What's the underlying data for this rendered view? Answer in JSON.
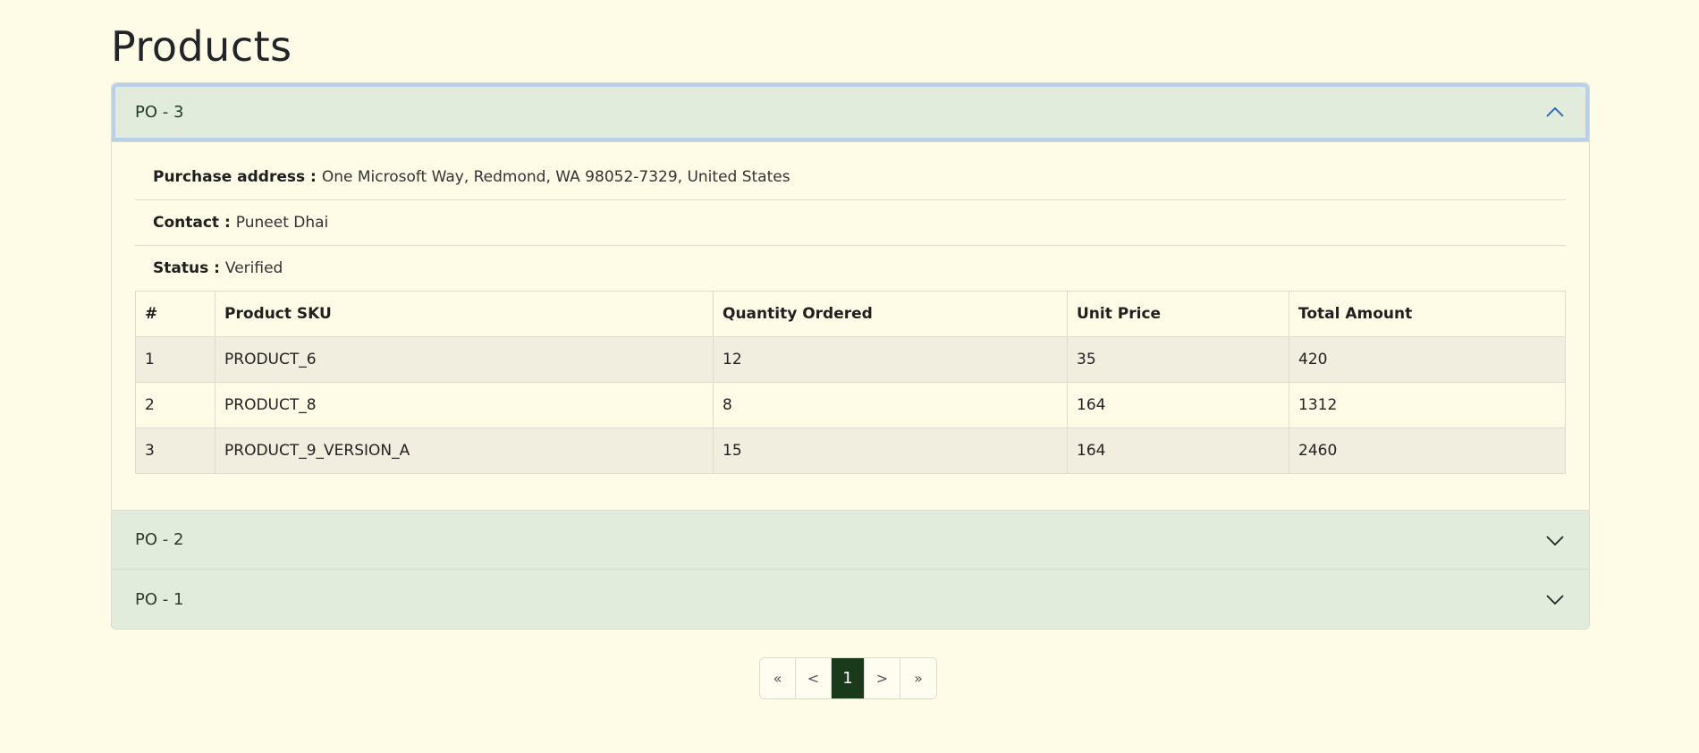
{
  "page": {
    "title": "Products"
  },
  "orders": [
    {
      "label": "PO - 3",
      "expanded": true,
      "details": {
        "address_label": "Purchase address :",
        "address": "One Microsoft Way, Redmond, WA 98052-7329, United States",
        "contact_label": "Contact :",
        "contact": "Puneet Dhai",
        "status_label": "Status :",
        "status": "Verified"
      },
      "table": {
        "columns": [
          "#",
          "Product SKU",
          "Quantity Ordered",
          "Unit Price",
          "Total Amount"
        ],
        "rows": [
          [
            "1",
            "PRODUCT_6",
            "12",
            "35",
            "420"
          ],
          [
            "2",
            "PRODUCT_8",
            "8",
            "164",
            "1312"
          ],
          [
            "3",
            "PRODUCT_9_VERSION_A",
            "15",
            "164",
            "2460"
          ]
        ]
      }
    },
    {
      "label": "PO - 2",
      "expanded": false
    },
    {
      "label": "PO - 1",
      "expanded": false
    }
  ],
  "pagination": {
    "first": "«",
    "prev": "<",
    "current": "1",
    "next": ">",
    "last": "»"
  },
  "icons": {
    "expanded": "chevron-up-icon",
    "collapsed": "chevron-down-icon"
  },
  "colors": {
    "background": "#fefbe7",
    "header": "#e1ecdd",
    "active_page": "#1a3a1c",
    "focus_ring": "#b9d0ea"
  }
}
